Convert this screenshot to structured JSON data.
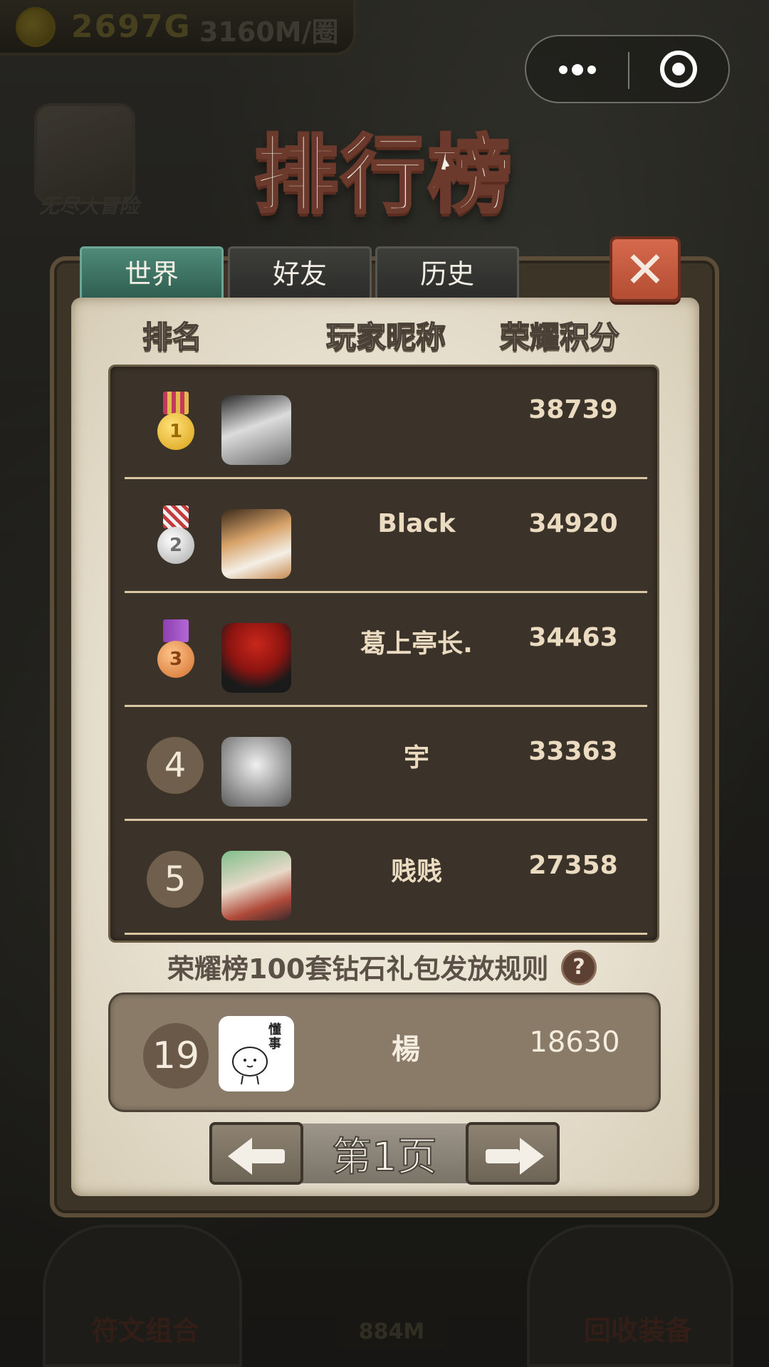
{
  "background": {
    "gold": "2697G",
    "rate": "3160M/圈",
    "hero_label": "无尽大冒险",
    "bottom_buttons": [
      "符文组合",
      "回收装备"
    ],
    "cost": "884M"
  },
  "title": "排行榜",
  "tabs": [
    {
      "label": "世界",
      "active": true
    },
    {
      "label": "好友",
      "active": false
    },
    {
      "label": "历史",
      "active": false
    }
  ],
  "close_icon": "close-icon",
  "columns": {
    "rank": "排名",
    "nickname": "玩家昵称",
    "score": "荣耀积分"
  },
  "rows": [
    {
      "rank": "1",
      "medal": "gold",
      "nickname": "",
      "score": "38739"
    },
    {
      "rank": "2",
      "medal": "silver",
      "nickname": "Black",
      "score": "34920"
    },
    {
      "rank": "3",
      "medal": "bronze",
      "nickname": "葛上亭长.",
      "score": "34463"
    },
    {
      "rank": "4",
      "nickname": "宇",
      "score": "33363"
    },
    {
      "rank": "5",
      "nickname": "贱贱",
      "score": "27358"
    }
  ],
  "rules_text": "荣耀榜100套钻石礼包发放规则",
  "help_label": "?",
  "me": {
    "rank": "19",
    "nickname": "楊",
    "score": "18630",
    "avatar_caption": "懂事"
  },
  "pager": {
    "label": "第1页"
  },
  "colors": {
    "active_tab": "#3f7566",
    "close": "#c45a3e",
    "row_bg": "#3b332a",
    "text": "#eadbc1"
  }
}
